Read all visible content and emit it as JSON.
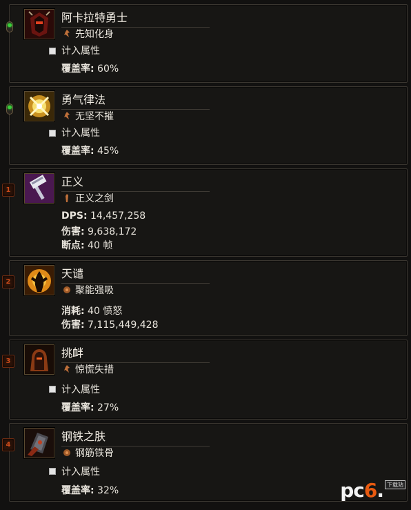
{
  "skills": [
    {
      "slot": "",
      "slot_type": "passive",
      "name": "阿卡拉特勇士",
      "rune": "先知化身",
      "checkbox_label": "计入属性",
      "stats": [
        {
          "label": "覆盖率:",
          "value": " 60%"
        }
      ]
    },
    {
      "slot": "",
      "slot_type": "passive",
      "name": "勇气律法",
      "rune": "无坚不摧",
      "checkbox_label": "计入属性",
      "stats": [
        {
          "label": "覆盖率:",
          "value": " 45%"
        }
      ]
    },
    {
      "slot": "1",
      "slot_type": "active",
      "name": "正义",
      "rune": "正义之剑",
      "stats": [
        {
          "label": "DPS:",
          "value": " 14,457,258"
        },
        {
          "label": "伤害:",
          "value": " 9,638,172"
        },
        {
          "label": "断点:",
          "value": " 40 帧"
        }
      ]
    },
    {
      "slot": "2",
      "slot_type": "active",
      "name": "天谴",
      "rune": "聚能强吸",
      "stats": [
        {
          "label": "消耗:",
          "value": " 40 愤怒"
        },
        {
          "label": "伤害:",
          "value": " 7,115,449,428"
        }
      ]
    },
    {
      "slot": "3",
      "slot_type": "active",
      "name": "挑衅",
      "rune": "惊慌失措",
      "checkbox_label": "计入属性",
      "stats": [
        {
          "label": "覆盖率:",
          "value": " 27%"
        }
      ]
    },
    {
      "slot": "4",
      "slot_type": "active",
      "name": "钢铁之肤",
      "rune": "钢筋铁骨",
      "checkbox_label": "计入属性",
      "stats": [
        {
          "label": "覆盖率:",
          "value": " 32%"
        }
      ]
    }
  ],
  "watermark": {
    "pre": "pc",
    "six": "6",
    "dot": ".",
    "sub": "下载站"
  },
  "colors": {
    "slot_number": "#c84a1a",
    "gem_green": "#3ad03a",
    "panel_border": "#3a3630"
  }
}
